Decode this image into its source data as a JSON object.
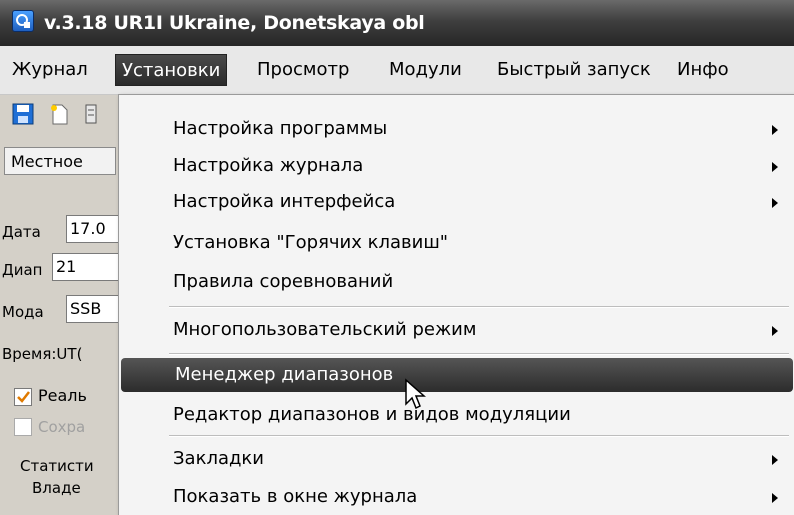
{
  "window": {
    "title": "v.3.18   UR1I Ukraine, Donetskaya obl",
    "icon": "app-icon"
  },
  "menubar": {
    "items": [
      "Журнал",
      "Установки",
      "Просмотр",
      "Модули",
      "Быстрый запуск",
      "Инфо"
    ],
    "active_index": 1
  },
  "toolbar": {
    "icons": [
      "save-icon",
      "new-icon",
      "tool-icon"
    ]
  },
  "left_panel": {
    "mode_combo": "Местное",
    "date_label": "Дата",
    "date_value": "17.0",
    "band_label": "Диап",
    "band_value": "21",
    "mode_label": "Мода",
    "mode_value": "SSB",
    "time_label": "Время:UT(",
    "realtime_label": "Реаль",
    "save_label": "Сохра",
    "stats_label": "Статисти",
    "owner_label": "Владе"
  },
  "dropdown": {
    "items": [
      {
        "label": "Настройка программы",
        "submenu": true
      },
      {
        "label": "Настройка журнала",
        "submenu": true
      },
      {
        "label": "Настройка интерфейса",
        "submenu": true
      },
      {
        "label": "Установка \"Горячих клавиш\"",
        "submenu": false
      },
      {
        "label": "Правила соревнований",
        "submenu": false
      },
      {
        "label": "Многопользовательский режим",
        "submenu": true
      },
      {
        "label": "Менеджер диапазонов",
        "submenu": false,
        "highlighted": true
      },
      {
        "label": "Редактор диапазонов и видов модуляции",
        "submenu": false
      },
      {
        "label": "Закладки",
        "submenu": true
      },
      {
        "label": "Показать в окне журнала",
        "submenu": true
      }
    ]
  },
  "colors": {
    "titlebar": "#3f3f3f",
    "highlight": "#3a3a3a",
    "menu_bg": "#f4f4f4"
  }
}
